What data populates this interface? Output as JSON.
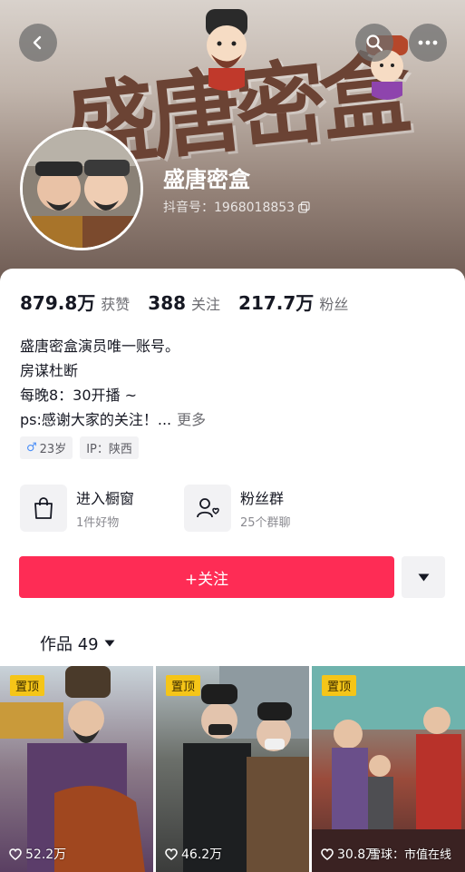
{
  "header": {
    "banner_art_text": "盛唐密盒",
    "name": "盛唐密盒",
    "douyin_id": "抖音号：1968018853",
    "icons": [
      "back-icon",
      "search-icon",
      "more-icon",
      "copy-icon"
    ]
  },
  "stats": [
    {
      "num": "879.8万",
      "label": "获赞"
    },
    {
      "num": "388",
      "label": "关注"
    },
    {
      "num": "217.7万",
      "label": "粉丝"
    }
  ],
  "bio": {
    "lines": [
      "盛唐密盒演员唯一账号。",
      "房谋杜断",
      "每晚8：30开播 ~",
      "ps:感谢大家的关注！..."
    ],
    "more": "更多"
  },
  "tags": {
    "gender_symbol": "♂",
    "age": "23岁",
    "ip": "IP：陕西"
  },
  "quick": [
    {
      "title": "进入橱窗",
      "sub": "1件好物",
      "icon": "shopping-bag-icon"
    },
    {
      "title": "粉丝群",
      "sub": "25个群聊",
      "icon": "fan-group-icon"
    }
  ],
  "follow": {
    "label": "+关注"
  },
  "works": {
    "label": "作品 49"
  },
  "videos": [
    {
      "pin": "置顶",
      "likes": "52.2万"
    },
    {
      "pin": "置顶",
      "likes": "46.2万"
    },
    {
      "pin": "置顶",
      "likes": "30.8万"
    }
  ],
  "watermark": "雪球：市值在线",
  "colors": {
    "accent": "#fe2c55",
    "pin": "#f5c518"
  }
}
